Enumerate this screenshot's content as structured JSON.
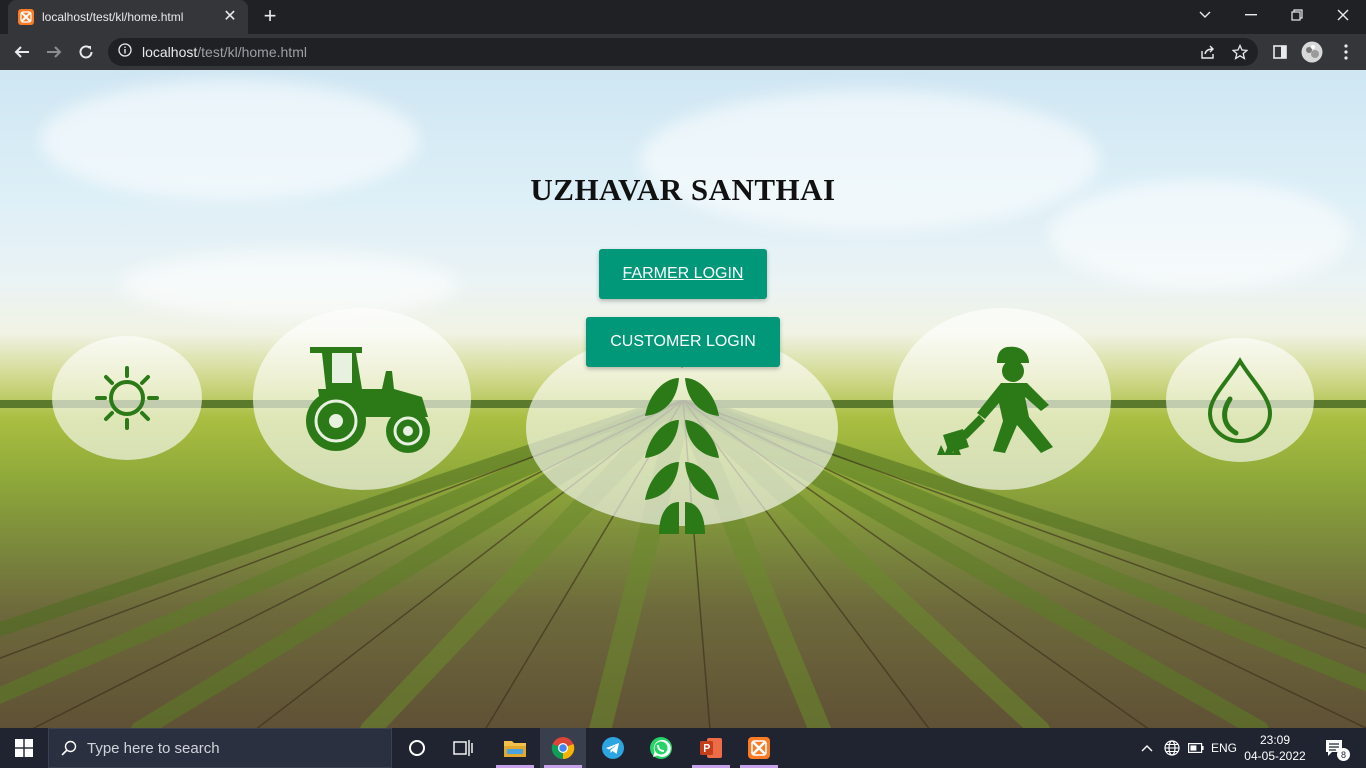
{
  "browser": {
    "tab_title": "localhost/test/kl/home.html",
    "tab_close": "✕",
    "new_tab": "+",
    "url_host": "localhost",
    "url_path": "/test/kl/home.html"
  },
  "page": {
    "title": "UZHAVAR SANTHAI",
    "farmer_login_label": "FARMER LOGIN",
    "customer_login_label": "CUSTOMER LOGIN",
    "icon_color": "#2b7a17",
    "button_color": "#009879"
  },
  "taskbar": {
    "search_placeholder": "Type here to search",
    "language": "ENG",
    "time": "23:09",
    "date": "04-05-2022",
    "notification_count": "8"
  }
}
